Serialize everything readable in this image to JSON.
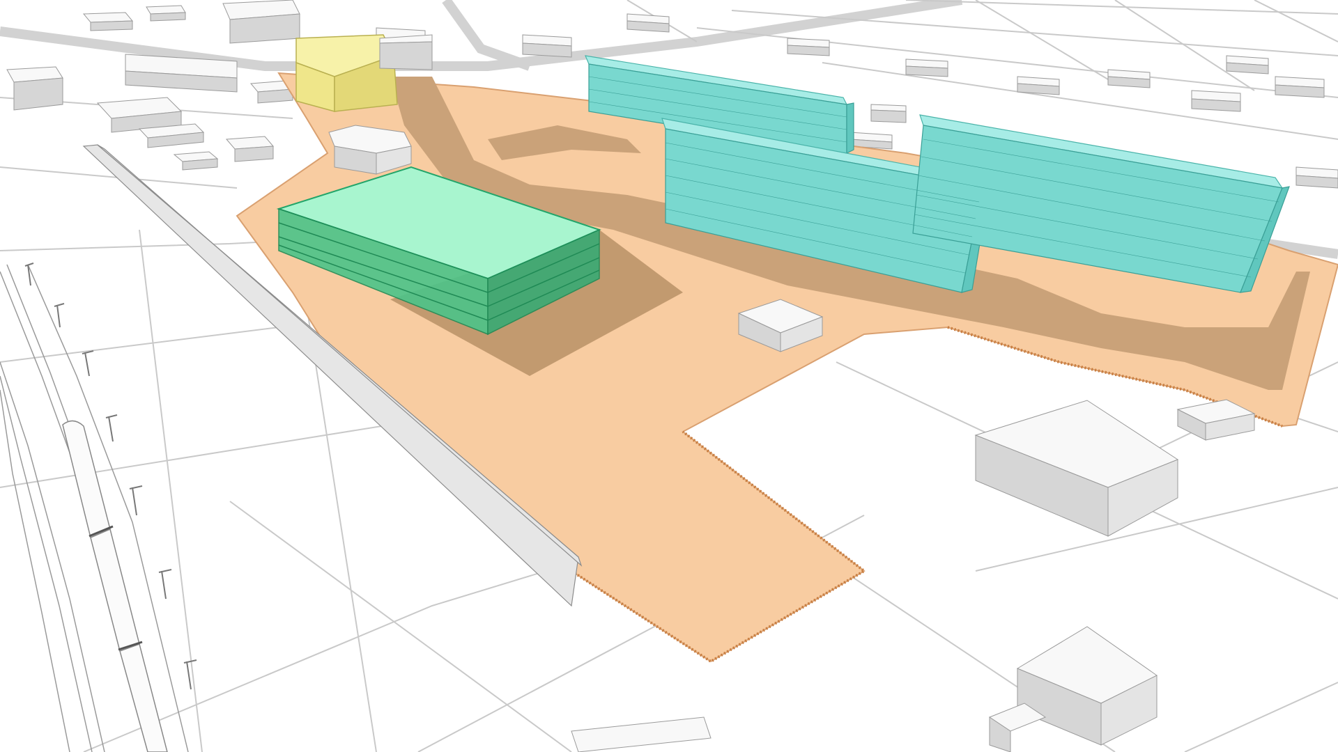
{
  "scene": {
    "description_visible_text": "",
    "colors": {
      "site_area": "#f8cca1",
      "site_path": "#caa279",
      "residential_blocks": "#79d8cf",
      "parking_structure": "#4cc489",
      "commercial_building": "#efe68a",
      "context_buildings": "#e4e4e4"
    }
  }
}
